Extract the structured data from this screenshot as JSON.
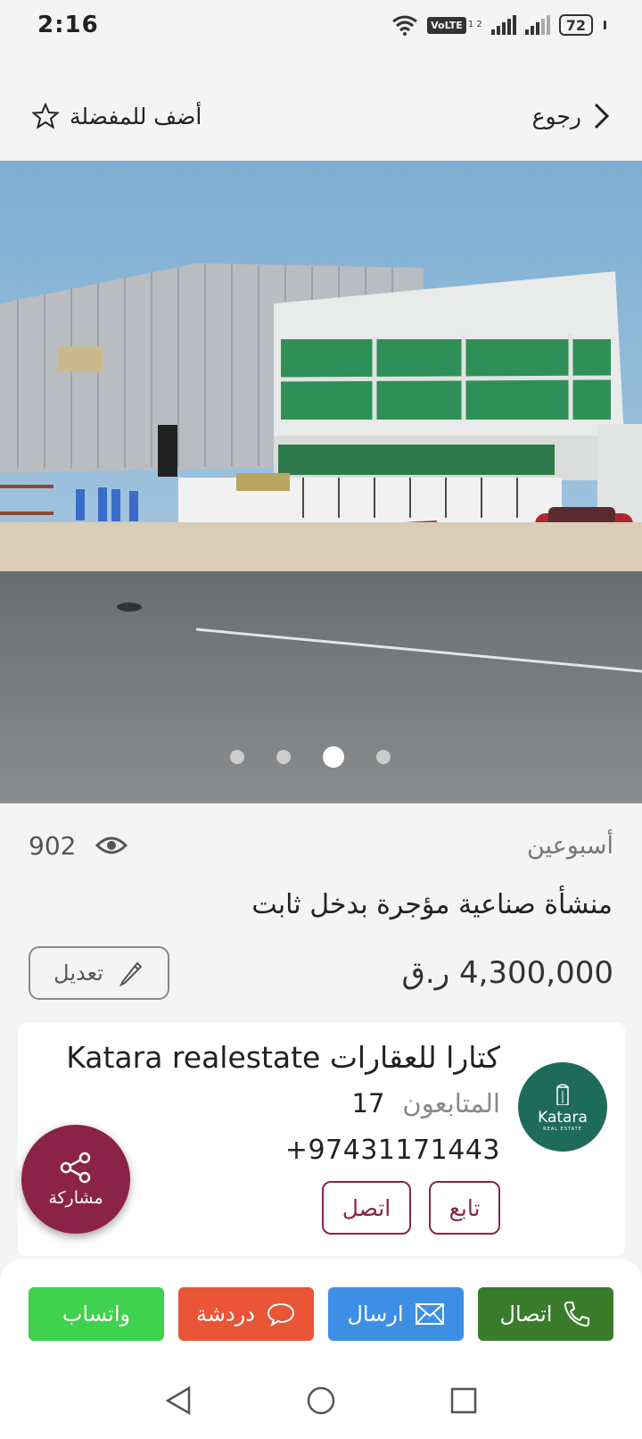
{
  "status_bar": {
    "time": "2:16",
    "volte": "VoLTE",
    "sim": "1 2",
    "battery": "72"
  },
  "nav": {
    "back_label": "رجوع",
    "favorite_label": "أضف للمفضلة"
  },
  "carousel": {
    "dot_count": 4,
    "active_index": 2
  },
  "listing": {
    "views": "902",
    "age": "أسبوعين",
    "title": "منشأة صناعية مؤجرة بدخل ثابت",
    "price": "4,300,000 ر.ق",
    "edit_label": "تعديل"
  },
  "agent": {
    "name": "Katara realestate  كتارا للعقارات",
    "followers_label": "المتابعون",
    "followers_count": "17",
    "phone": "+97431171443",
    "follow_label": "تابع",
    "contact_label": "اتصل",
    "logo_text": "Katara",
    "logo_sub": "REAL ESTATE"
  },
  "share": {
    "label": "مشاركة"
  },
  "actions": {
    "call": "اتصال",
    "send": "ارسال",
    "chat": "دردشة",
    "whatsapp": "واتساب"
  },
  "colors": {
    "brand": "#8b2348",
    "call": "#3a7b2c",
    "send": "#3d8fe6",
    "chat": "#ea5437",
    "whatsapp": "#40d14e",
    "logo_bg": "#1f6b5b"
  }
}
